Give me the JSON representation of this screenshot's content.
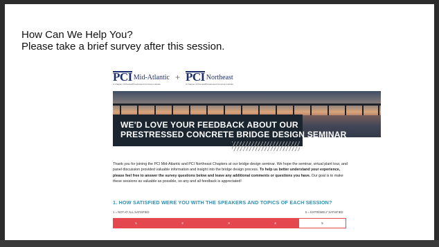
{
  "slide": {
    "title_line1": "How Can We Help You?",
    "title_line2": "Please take a brief survey after this session."
  },
  "logos": {
    "left": {
      "mark": "PCI",
      "region": "Mid-Atlantic",
      "tagline": "A Chapter of Precast/Prestressed Concrete Institute"
    },
    "separator": "+",
    "right": {
      "mark": "PCI",
      "region": "Northeast",
      "tagline": "A Chapter of Precast/Prestressed Concrete Institute"
    }
  },
  "banner": {
    "headline_line1": "WE'D LOVE YOUR FEEDBACK ABOUT OUR",
    "headline_line2": "PRESTRESSED CONCRETE BRIDGE DESIGN SEMINAR"
  },
  "intro": {
    "text_part1": "Thank you for joining the PCI Mid-Atlantic and PCI Northeast Chapters at our bridge design seminar. We hope the seminar, virtual plant tour, and panel discussion provided valuable information and insight into the bridge design process.",
    "text_bold": "To help us better understand your experience, please feel free to answer the survey questions below and leave any additional comments or questions you have.",
    "text_part2": "Our goal is to make these sessions as valuable as possible, so any and all feedback is appreciated!"
  },
  "survey": {
    "question": "1. HOW SATISFIED WERE YOU WITH THE SPEAKERS AND TOPICS OF EACH SESSION?",
    "scale_low": "1 = NOT AT ALL SATISFIED",
    "scale_high": "5 = EXTREMELY SATISFIED",
    "options": [
      "1",
      "2",
      "3",
      "4",
      "5"
    ]
  },
  "colors": {
    "accent_red": "#e5474f",
    "question_blue": "#2a8fb4",
    "headline_bg": "#1a2530",
    "logo_navy": "#1d2f6a"
  }
}
